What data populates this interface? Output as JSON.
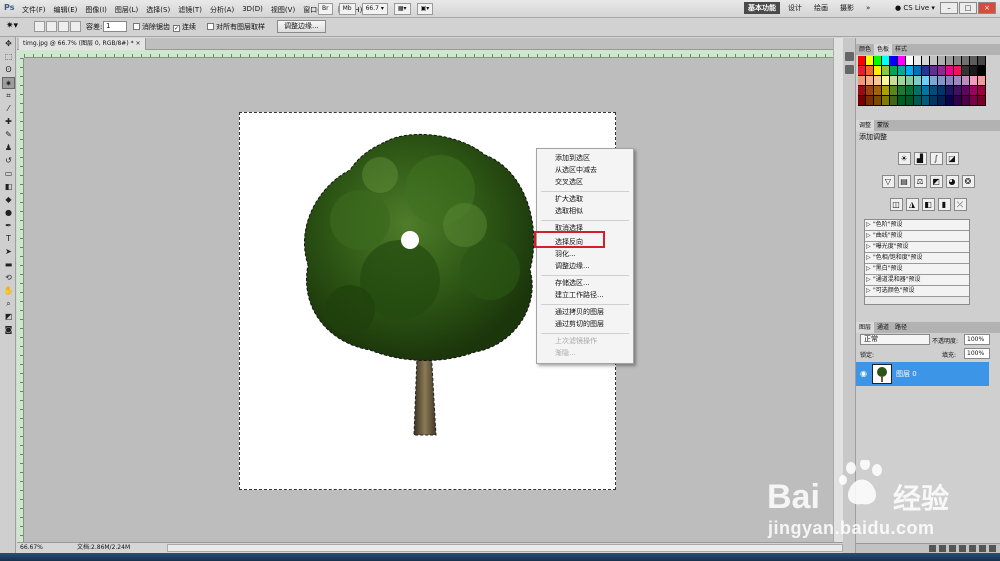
{
  "app": {
    "logo": "Ps"
  },
  "menubar": {
    "items": [
      "文件(F)",
      "编辑(E)",
      "图像(I)",
      "图层(L)",
      "选择(S)",
      "滤镜(T)",
      "分析(A)",
      "3D(D)",
      "视图(V)",
      "窗口(W)",
      "帮助(H)"
    ],
    "tool_icons": [
      "Br",
      "Mb"
    ],
    "zoom": "66.7",
    "workspaces": [
      "基本功能",
      "设计",
      "绘画",
      "摄影"
    ],
    "more": "»",
    "cs_live": "CS Live",
    "window_buttons": [
      "–",
      "□",
      "×"
    ]
  },
  "options": {
    "tolerance_label": "容差:",
    "tolerance_value": "1",
    "antialias_label": "消除锯齿",
    "contiguous_label": "连续",
    "all_layers_label": "对所有图层取样",
    "refine_button": "调整边缘..."
  },
  "document": {
    "tab_title": "timg.jpg @ 66.7% (图层 0, RGB/8#) *",
    "tab_close": "×"
  },
  "status": {
    "zoom": "66.67%",
    "doc_size": "文档:2.86M/2.24M"
  },
  "context_menu": {
    "items": [
      {
        "label": "添加到选区",
        "disabled": false
      },
      {
        "label": "从选区中减去",
        "disabled": false
      },
      {
        "label": "交叉选区",
        "disabled": false
      },
      {
        "label": "扩大选取",
        "disabled": false
      },
      {
        "label": "选取相似",
        "disabled": false
      },
      {
        "label": "取消选择",
        "disabled": false
      },
      {
        "label": "选择反向",
        "disabled": false
      },
      {
        "label": "羽化...",
        "disabled": false
      },
      {
        "label": "调整边缘...",
        "disabled": false
      },
      {
        "label": "存储选区...",
        "disabled": false
      },
      {
        "label": "建立工作路径...",
        "disabled": false
      },
      {
        "label": "通过拷贝的图层",
        "disabled": false
      },
      {
        "label": "通过剪切的图层",
        "disabled": false
      },
      {
        "label": "上次滤镜操作",
        "disabled": true
      },
      {
        "label": "渐隐...",
        "disabled": true
      }
    ],
    "highlighted": "选择反向",
    "highlight_color": "#d2202a"
  },
  "panels": {
    "swatch_tabs": [
      "颜色",
      "色板",
      "样式"
    ],
    "adjust_tabs": [
      "调整",
      "蒙版"
    ],
    "adjust_title": "添加调整",
    "presets": [
      "\"色阶\"预设",
      "\"曲线\"预设",
      "\"曝光度\"预设",
      "\"色相/饱和度\"预设",
      "\"黑白\"预设",
      "\"通道混和器\"预设",
      "\"可选颜色\"预设"
    ],
    "layer_tabs": [
      "图层",
      "通道",
      "路径"
    ],
    "blend_mode": "正常",
    "opacity_label": "不透明度:",
    "opacity_value": "100%",
    "lock_label": "锁定:",
    "fill_label": "填充:",
    "fill_value": "100%",
    "layer_name": "图层 0",
    "selection_color": "#3d95e8"
  },
  "watermark": {
    "brand": "Bai",
    "brand_cn": "经验",
    "url": "jingyan.baidu.com"
  }
}
